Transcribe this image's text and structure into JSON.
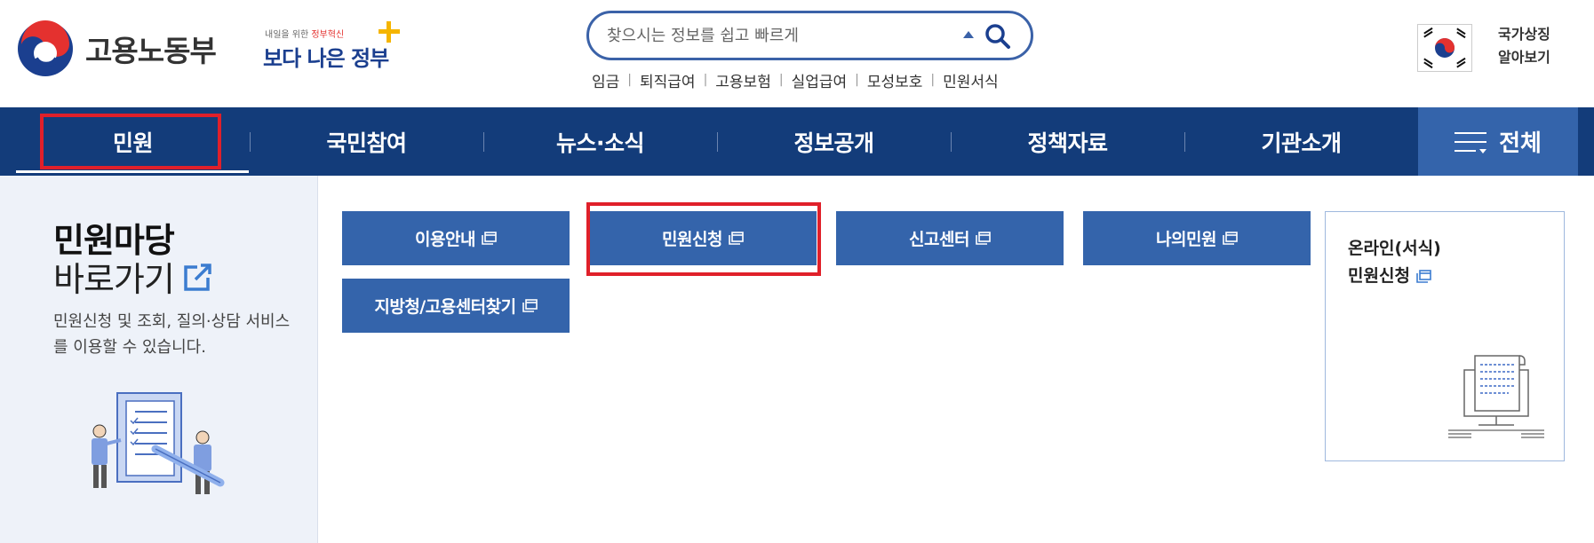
{
  "header": {
    "logo_text": "고용노동부",
    "gov_badge": {
      "small_prefix": "내일을 위한 ",
      "small_highlight": "정부혁신",
      "big": "보다 나은 정부"
    },
    "search": {
      "placeholder": "찾으시는 정보를 쉽고 빠르게",
      "value": ""
    },
    "quick_links": [
      "임금",
      "퇴직급여",
      "고용보험",
      "실업급여",
      "모성보호",
      "민원서식"
    ],
    "symbol_link_line1": "국가상징",
    "symbol_link_line2": "알아보기"
  },
  "nav": {
    "items": [
      "민원",
      "국민참여",
      "뉴스·소식",
      "정보공개",
      "정책자료",
      "기관소개"
    ],
    "all_label": "전체",
    "active": "민원"
  },
  "left_panel": {
    "title": "민원마당",
    "subtitle": "바로가기",
    "description": "민원신청 및 조회, 질의·상담 서비스를 이용할 수 있습니다."
  },
  "buttons": {
    "guide": "이용안내",
    "apply": "민원신청",
    "report": "신고센터",
    "my": "나의민원",
    "offices": "지방청/고용센터찾기"
  },
  "card": {
    "line1": "온라인(서식)",
    "line2": "민원신청"
  },
  "colors": {
    "nav_bg": "#133c7a",
    "button_bg": "#3464ab",
    "highlight": "#e0202a",
    "left_panel_bg": "#eef2f9"
  }
}
